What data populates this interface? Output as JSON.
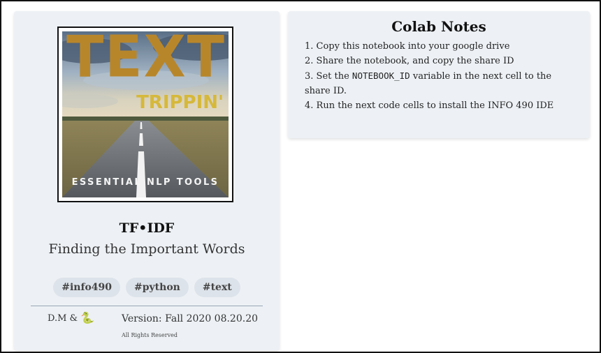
{
  "left_card": {
    "cover": {
      "big_word": "TEXT",
      "sub_word": "TRIPPIN'",
      "tagline": "ESSENTIAL NLP TOOLS"
    },
    "title": "TF•IDF",
    "subtitle": "Finding the Important Words",
    "tags": [
      "#info490",
      "#python",
      "#text"
    ],
    "author": "D.M &",
    "author_icon": "snake-icon",
    "version": "Version: Fall 2020 08.20.20",
    "rights": "All Rights Reserved"
  },
  "notes": {
    "title": "Colab Notes",
    "item1": "1. Copy this notebook into your google drive",
    "item2": "2. Share the notebook, and copy the share ID",
    "item3_prefix": "3. Set the ",
    "item3_code": "NOTEBOOK_ID",
    "item3_suffix": " variable in the next cell to the share ID.",
    "item4": "4. Run the next code cells to install the INFO 490 IDE"
  },
  "colors": {
    "card_bg": "#edf1f5",
    "tag_bg": "#dde3ea",
    "cover_gold": "#b8862a",
    "cover_yellow": "#d6b83a"
  }
}
